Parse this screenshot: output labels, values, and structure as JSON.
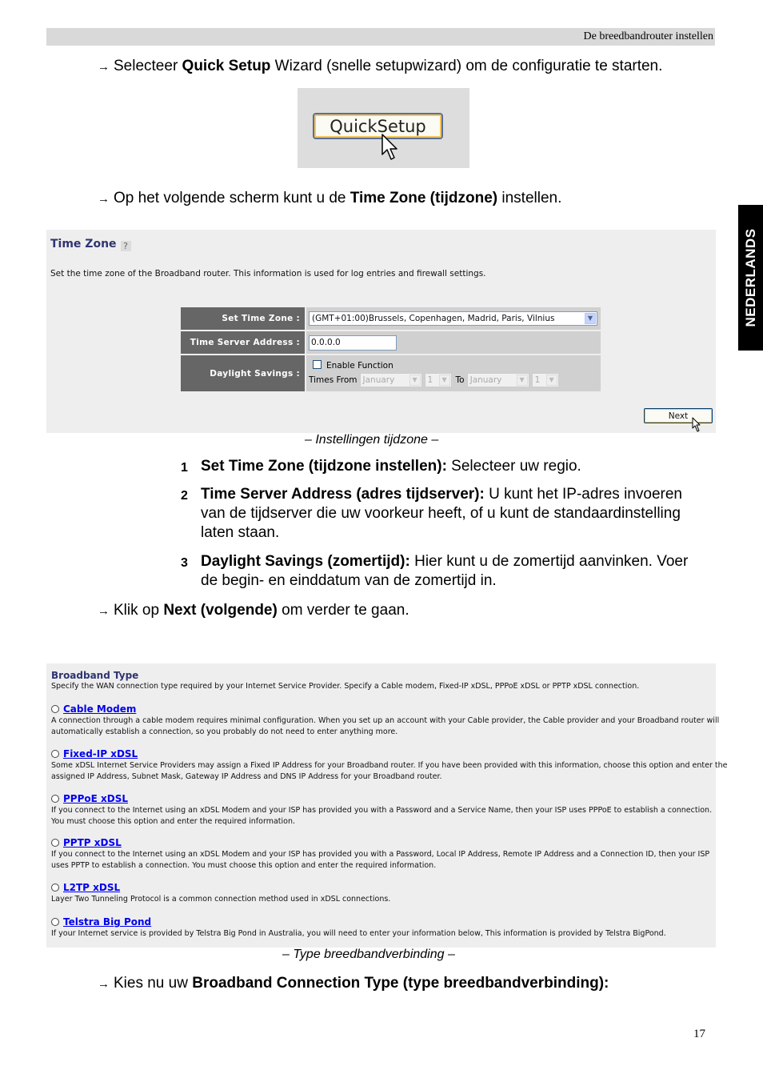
{
  "header": {
    "running_title": "De breedbandrouter instellen"
  },
  "side_tab": {
    "language": "NEDERLANDS"
  },
  "steps": {
    "quick_setup": {
      "prefix": "Selecteer ",
      "bold": "Quick Setup",
      "suffix": " Wizard (snelle setupwizard) om de configuratie te starten."
    },
    "time_zone": {
      "prefix": "Op het volgende scherm kunt u de ",
      "bold": "Time Zone (tijdzone)",
      "suffix": " instellen."
    },
    "next": {
      "prefix": "Klik op ",
      "bold": "Next (volgende)",
      "suffix": " om verder te gaan."
    },
    "broadband": {
      "prefix": "Kies nu uw ",
      "bold": "Broadband Connection Type (type breedbandverbinding):",
      "suffix": ""
    }
  },
  "quick_setup_image": {
    "button_label": "QuickSetup"
  },
  "time_zone_panel": {
    "title": "Time Zone",
    "description": "Set the time zone of the Broadband router. This information is used for log entries and firewall settings.",
    "set_time_zone": {
      "label": "Set Time Zone :",
      "value": "(GMT+01:00)Brussels, Copenhagen, Madrid, Paris, Vilnius"
    },
    "time_server": {
      "label": "Time Server Address :",
      "value": "0.0.0.0"
    },
    "daylight": {
      "label": "Daylight Savings :",
      "enable_label": "Enable Function",
      "enabled": false,
      "times_from_label": "Times From",
      "from_month": "January",
      "from_day": "1",
      "to_label": "To",
      "to_month": "January",
      "to_day": "1"
    },
    "next_label": "Next"
  },
  "captions": {
    "time_zone": "– Instellingen tijdzone –",
    "broadband": "– Type breedbandverbinding –"
  },
  "numbered_items": [
    {
      "num": "1",
      "bold": "Set Time Zone (tijdzone instellen):",
      "line1": " Selecteer uw regio.",
      "line2": "",
      "line3": ""
    },
    {
      "num": "2",
      "bold": "Time Server Address (adres tijdserver):",
      "line1": " U kunt het IP-adres invoeren",
      "line2": "van de tijdserver die uw voorkeur heeft, of u kunt de standaardinstelling",
      "line3": "laten staan."
    },
    {
      "num": "3",
      "bold": "Daylight Savings (zomertijd):",
      "line1": " Hier kunt u de zomertijd aanvinken. Voer",
      "line2": "de begin- en einddatum van de zomertijd in.",
      "line3": ""
    }
  ],
  "broadband_panel": {
    "title": "Broadband Type",
    "description": "Specify the WAN connection type required by your Internet Service Provider. Specify a Cable modem, Fixed-IP xDSL, PPPoE xDSL or PPTP xDSL connection.",
    "options": [
      {
        "label": "Cable Modem",
        "lines": [
          "A connection through a cable modem requires minimal configuration. When you set up an account with your Cable provider, the Cable provider and your Broadband router will",
          "automatically establish a connection, so you probably do not need to enter anything more."
        ]
      },
      {
        "label": "Fixed-IP xDSL",
        "lines": [
          "Some xDSL Internet Service Providers may assign a Fixed IP Address for your Broadband router. If you have been provided with this information, choose this option and enter the",
          "assigned IP Address, Subnet Mask, Gateway IP Address and DNS IP Address for your Broadband router."
        ]
      },
      {
        "label": "PPPoE xDSL",
        "lines": [
          "If you connect to the Internet using an xDSL Modem and your ISP has provided you with a Password and a Service Name, then your ISP uses PPPoE to establish a connection.",
          "You must choose this option and enter the required information."
        ]
      },
      {
        "label": "PPTP xDSL",
        "lines": [
          "If you connect to the Internet using an xDSL Modem and your ISP has provided you with a Password, Local IP Address, Remote IP Address and a Connection ID, then your ISP",
          "uses PPTP to establish a connection. You must choose this option and enter the required information."
        ]
      },
      {
        "label": "L2TP xDSL",
        "lines": [
          "Layer Two Tunneling Protocol is a common connection method used in xDSL connections.",
          ""
        ]
      },
      {
        "label": "Telstra Big Pond",
        "lines": [
          "If your Internet service is provided by Telstra Big Pond in Australia, you will need to enter your information below, This information is provided by Telstra BigPond.",
          ""
        ]
      }
    ]
  },
  "footer": {
    "page_number": "17"
  }
}
